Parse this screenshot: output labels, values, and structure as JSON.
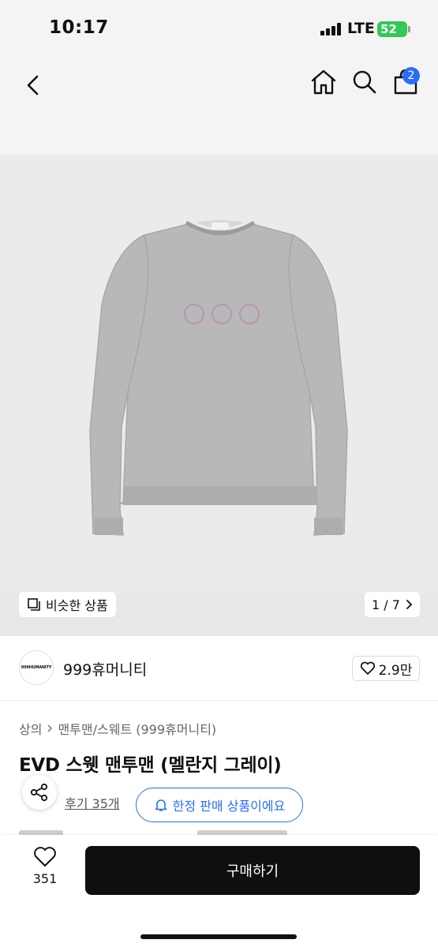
{
  "status_bar": {
    "time": "10:17",
    "network": "LTE",
    "battery": "52"
  },
  "nav": {
    "cart_count": "2"
  },
  "gallery": {
    "similar_label": "비슷한 상품",
    "page_indicator": "1 / 7"
  },
  "shop": {
    "logo_text": "999HUMANITY",
    "name": "999휴머니티",
    "likes": "2.9만"
  },
  "breadcrumb": {
    "items": [
      "상의",
      "맨투맨/스웨트 (999휴머니티)"
    ]
  },
  "product": {
    "title": "EVD 스웻 맨투맨 (멜란지 그레이)",
    "review_label": "후기 35개",
    "limited_label": "한정 판매 상품이에요"
  },
  "bottom": {
    "wish_count": "351",
    "buy_label": "구매하기"
  },
  "colors": {
    "accent": "#2a6df4",
    "buy_button": "#0f0f0f",
    "battery": "#34c759",
    "sweatshirt": "#b8b8b8"
  },
  "icons": [
    "back-chevron-icon",
    "home-icon",
    "search-icon",
    "cart-icon",
    "similar-items-icon",
    "chevron-right-icon",
    "heart-icon",
    "share-icon",
    "bell-icon"
  ]
}
